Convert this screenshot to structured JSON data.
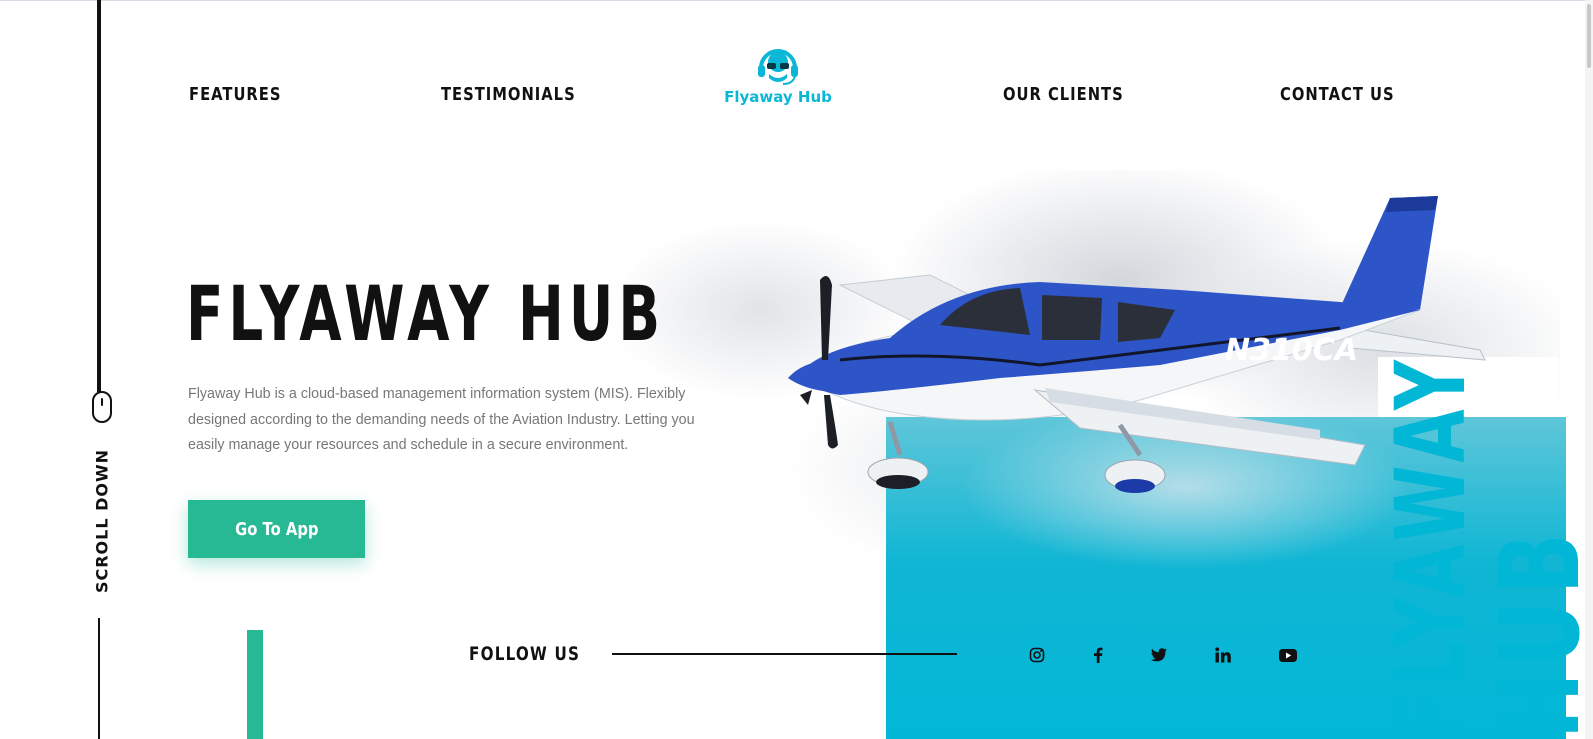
{
  "nav": {
    "features": "FEATURES",
    "testimonials": "TESTIMONIALS",
    "our_clients": "OUR CLIENTS",
    "contact_us": "CONTACT US"
  },
  "logo": {
    "text": "Flyaway Hub",
    "icon": "pilot-headset-icon",
    "color": "#0ab7d6"
  },
  "hero": {
    "title": "FLYAWAY HUB",
    "description": "Flyaway Hub is a cloud-based management information system (MIS). Flexibly designed according to the demanding needs of the Aviation Industry. Letting you easily manage your resources and schedule in a secure environment.",
    "cta_label": "Go To App",
    "plane_tail": "N310CA",
    "vertical_word_1": "FLYAWAY",
    "vertical_word_2": "HUB"
  },
  "scroll": {
    "label": "SCROLL DOWN",
    "icon": "mouse-icon"
  },
  "follow": {
    "label": "FOLLOW US",
    "icons": [
      "instagram-icon",
      "facebook-icon",
      "twitter-icon",
      "linkedin-icon",
      "youtube-icon"
    ]
  },
  "colors": {
    "accent_green": "#26b994",
    "accent_teal": "#02b7d6",
    "plane_blue": "#2d55c8"
  }
}
